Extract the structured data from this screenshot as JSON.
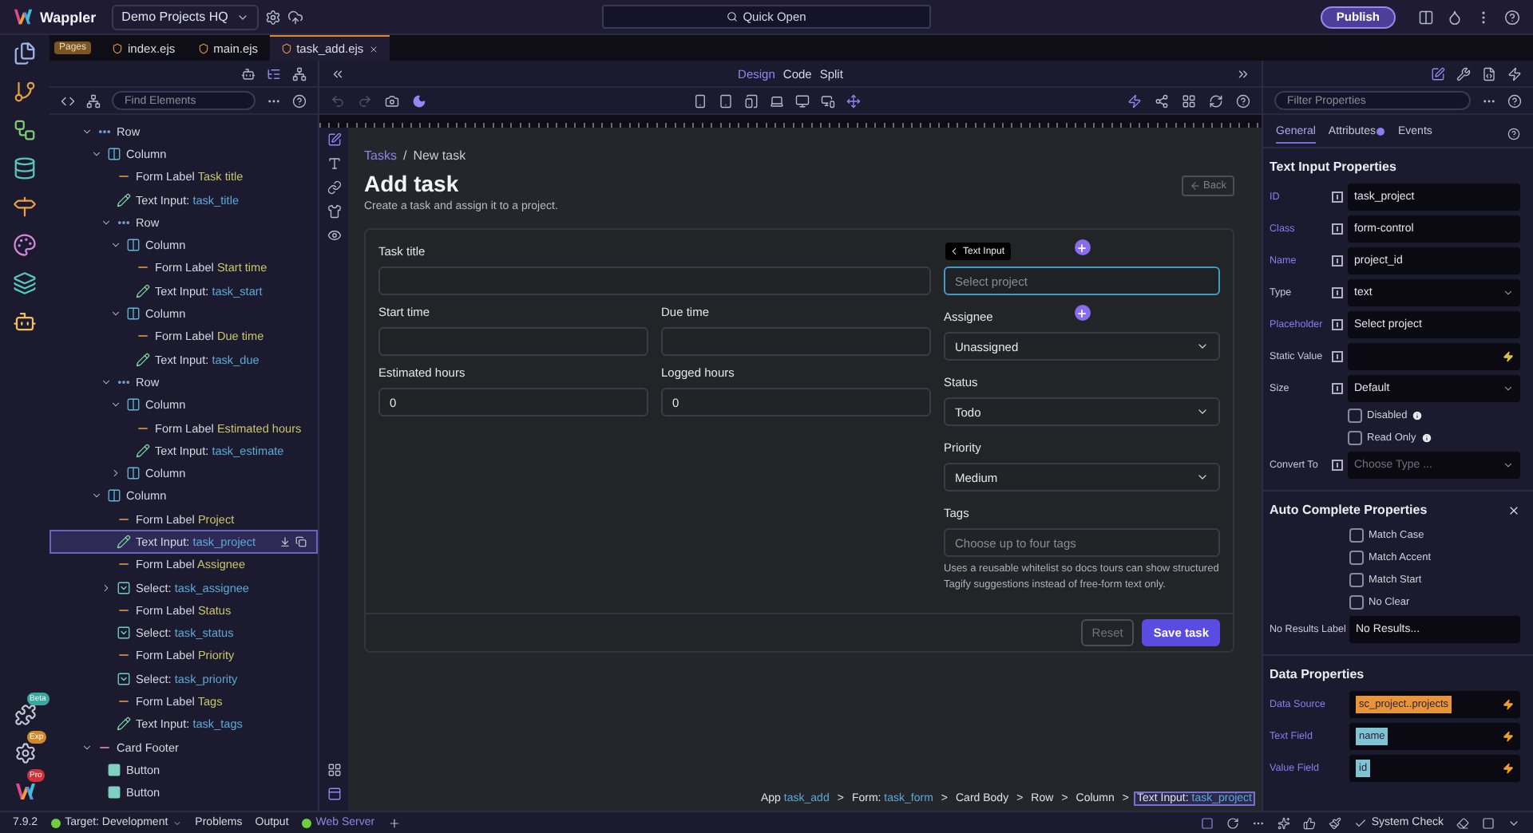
{
  "top_bar": {
    "app_name": "Wappler",
    "project": "Demo Projects HQ",
    "quick_open": "Quick Open",
    "publish": "Publish"
  },
  "rail_badges": [
    "Beta",
    "Exp",
    "Pro"
  ],
  "file_tabs": {
    "badge": "Pages",
    "tabs": [
      {
        "label": "index.ejs",
        "selected": false
      },
      {
        "label": "main.ejs",
        "selected": false
      },
      {
        "label": "task_add.ejs",
        "selected": true
      }
    ]
  },
  "structure_panel": {
    "search_placeholder": "Find Elements",
    "tree": [
      {
        "kind": "row",
        "type": "Row",
        "expanded": true,
        "selected": false,
        "children": [
          {
            "kind": "column",
            "type": "Column",
            "expanded": true,
            "selected": false,
            "children": [
              {
                "kind": "label",
                "type": "Form Label",
                "name": "Task title",
                "selected": false
              },
              {
                "kind": "input",
                "type": "Text Input:",
                "name": "task_title",
                "selected": false
              },
              {
                "kind": "row",
                "type": "Row",
                "expanded": true,
                "selected": false,
                "children": [
                  {
                    "kind": "column",
                    "type": "Column",
                    "expanded": true,
                    "selected": false,
                    "children": [
                      {
                        "kind": "label",
                        "type": "Form Label",
                        "name": "Start time",
                        "selected": false
                      },
                      {
                        "kind": "input",
                        "type": "Text Input:",
                        "name": "task_start",
                        "selected": false
                      }
                    ]
                  },
                  {
                    "kind": "column",
                    "type": "Column",
                    "expanded": true,
                    "selected": false,
                    "children": [
                      {
                        "kind": "label",
                        "type": "Form Label",
                        "name": "Due time",
                        "selected": false
                      },
                      {
                        "kind": "input",
                        "type": "Text Input:",
                        "name": "task_due",
                        "selected": false
                      }
                    ]
                  }
                ]
              },
              {
                "kind": "row",
                "type": "Row",
                "expanded": true,
                "selected": false,
                "children": [
                  {
                    "kind": "column",
                    "type": "Column",
                    "expanded": true,
                    "selected": false,
                    "children": [
                      {
                        "kind": "label",
                        "type": "Form Label",
                        "name": "Estimated hours",
                        "selected": false
                      },
                      {
                        "kind": "input",
                        "type": "Text Input:",
                        "name": "task_estimate",
                        "selected": false
                      }
                    ]
                  },
                  {
                    "kind": "column",
                    "type": "Column",
                    "expanded": false,
                    "selected": false
                  }
                ]
              }
            ]
          },
          {
            "kind": "column",
            "type": "Column",
            "expanded": true,
            "selected": false,
            "children": [
              {
                "kind": "label",
                "type": "Form Label",
                "name": "Project",
                "selected": false
              },
              {
                "kind": "input",
                "type": "Text Input:",
                "name": "task_project",
                "selected": true
              },
              {
                "kind": "label",
                "type": "Form Label",
                "name": "Assignee",
                "selected": false
              },
              {
                "kind": "select",
                "type": "Select:",
                "name": "task_assignee",
                "expanded": false,
                "selected": false
              },
              {
                "kind": "label",
                "type": "Form Label",
                "name": "Status",
                "selected": false
              },
              {
                "kind": "select",
                "type": "Select:",
                "name": "task_status",
                "selected": false
              },
              {
                "kind": "label",
                "type": "Form Label",
                "name": "Priority",
                "selected": false
              },
              {
                "kind": "select",
                "type": "Select:",
                "name": "task_priority",
                "selected": false
              },
              {
                "kind": "label",
                "type": "Form Label",
                "name": "Tags",
                "selected": false
              },
              {
                "kind": "input",
                "type": "Text Input:",
                "name": "task_tags",
                "selected": false
              }
            ]
          }
        ]
      },
      {
        "kind": "footer",
        "type": "Card Footer",
        "expanded": true,
        "selected": false,
        "children": [
          {
            "kind": "button",
            "type": "Button",
            "selected": false
          },
          {
            "kind": "button",
            "type": "Button",
            "selected": false
          }
        ]
      }
    ]
  },
  "view_modes": [
    {
      "label": "Design",
      "selected": true
    },
    {
      "label": "Code",
      "selected": false
    },
    {
      "label": "Split",
      "selected": false
    }
  ],
  "page": {
    "crumbs": [
      {
        "label": "Tasks",
        "link": true
      },
      {
        "label": "New task",
        "link": false
      }
    ],
    "crumb_separator": "/",
    "title": "Add task",
    "subtitle": "Create a task and assign it to a project.",
    "back": {
      "label": "Back",
      "disabled": true
    },
    "main_fields": [
      {
        "label": "Task title",
        "kind": "input",
        "selected": false
      }
    ],
    "field_rows": [
      [
        {
          "label": "Start time",
          "kind": "input",
          "selected": false
        },
        {
          "label": "Due time",
          "kind": "input",
          "selected": false
        }
      ],
      [
        {
          "label": "Estimated hours",
          "kind": "input",
          "value": "0",
          "selected": false
        },
        {
          "label": "Logged hours",
          "kind": "input",
          "value": "0",
          "selected": false
        }
      ]
    ],
    "side_fields": [
      {
        "kind": "input",
        "placeholder": "Select project",
        "selected": true,
        "tooltip": "Text Input"
      },
      {
        "label": "Assignee",
        "kind": "select",
        "value": "Unassigned",
        "selected": false
      },
      {
        "label": "Status",
        "kind": "select",
        "value": "Todo",
        "selected": false
      },
      {
        "label": "Priority",
        "kind": "select",
        "value": "Medium",
        "selected": false
      },
      {
        "label": "Tags",
        "kind": "input",
        "placeholder": "Choose up to four tags",
        "selected": false,
        "help": "Uses a reusable whitelist so docs tours can show structured Tagify suggestions instead of free-form text only."
      }
    ],
    "buttons": [
      {
        "label": "Reset",
        "kind": "secondary",
        "disabled": true
      },
      {
        "label": "Save task",
        "kind": "primary",
        "disabled": false
      }
    ]
  },
  "element_path": {
    "separator": ">",
    "items": [
      {
        "type": "App",
        "name": "task_add",
        "selected": false
      },
      {
        "type": "Form:",
        "name": "task_form",
        "selected": false
      },
      {
        "type": "Card Body",
        "selected": false
      },
      {
        "type": "Row",
        "selected": false
      },
      {
        "type": "Column",
        "selected": false
      },
      {
        "type": "Text Input:",
        "name": "task_project",
        "selected": true
      }
    ]
  },
  "properties": {
    "filter_placeholder": "Filter Properties",
    "tabs": [
      {
        "label": "General",
        "selected": true,
        "dot": false
      },
      {
        "label": "Attributes",
        "selected": false,
        "dot": true
      },
      {
        "label": "Events",
        "selected": false,
        "dot": false
      }
    ],
    "sections": [
      {
        "title": "Text Input Properties",
        "bindable": true,
        "closable": false,
        "rows": [
          {
            "kind": "input",
            "label": "ID",
            "value": "task_project",
            "set": true
          },
          {
            "kind": "input",
            "label": "Class",
            "value": "form-control",
            "set": true
          },
          {
            "kind": "input",
            "label": "Name",
            "value": "project_id",
            "set": true
          },
          {
            "kind": "select",
            "label": "Type",
            "value": "text",
            "set": false
          },
          {
            "kind": "input",
            "label": "Placeholder",
            "value": "Select project",
            "set": true
          },
          {
            "kind": "dynamic",
            "label": "Static Value",
            "set": false
          },
          {
            "kind": "select",
            "label": "Size",
            "value": "Default",
            "set": false
          },
          {
            "kind": "checkbox",
            "label": "Disabled",
            "checked": false,
            "info": true
          },
          {
            "kind": "checkbox",
            "label": "Read Only",
            "checked": false,
            "info": true
          },
          {
            "kind": "select",
            "label": "Convert To",
            "placeholder": "Choose Type ...",
            "set": false
          }
        ]
      },
      {
        "title": "Auto Complete Properties",
        "bindable": false,
        "closable": true,
        "rows": [
          {
            "kind": "checkbox",
            "label": "Match Case",
            "checked": false,
            "info": false
          },
          {
            "kind": "checkbox",
            "label": "Match Accent",
            "checked": false,
            "info": false
          },
          {
            "kind": "checkbox",
            "label": "Match Start",
            "checked": false,
            "info": false
          },
          {
            "kind": "checkbox",
            "label": "No Clear",
            "checked": false,
            "info": false
          },
          {
            "kind": "input",
            "label": "No Results Label",
            "value": "No Results...",
            "set": false
          }
        ]
      },
      {
        "title": "Data Properties",
        "bindable": false,
        "closable": false,
        "rows": [
          {
            "kind": "dynamic",
            "label": "Data Source",
            "value": "sc_project..projects",
            "color": "#e8953a",
            "set": true
          },
          {
            "kind": "dynamic",
            "label": "Text Field",
            "value": "name",
            "color": "#7fc4d4",
            "set": true
          },
          {
            "kind": "dynamic",
            "label": "Value Field",
            "value": "id",
            "color": "#7fc4d4",
            "set": true
          }
        ]
      }
    ]
  },
  "status_bar": {
    "version": "7.9.2",
    "target": "Target: Development",
    "panels": [
      "Problems",
      "Output"
    ],
    "server": "Web Server",
    "system_check": "System Check"
  }
}
